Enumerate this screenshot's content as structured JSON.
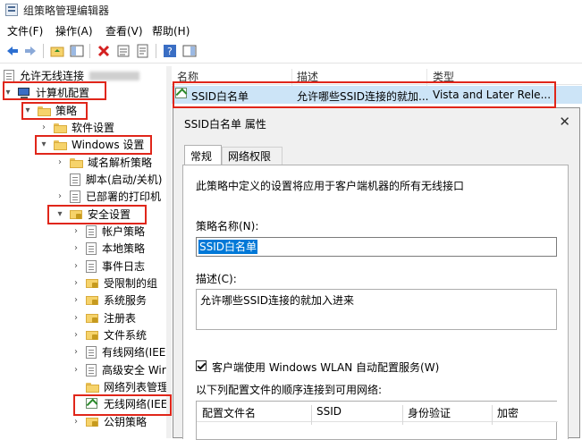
{
  "window": {
    "title": "组策略管理编辑器"
  },
  "menu": {
    "file": "文件(F)",
    "action": "操作(A)",
    "view": "查看(V)",
    "help": "帮助(H)"
  },
  "tree": {
    "root_label": "允许无线连接",
    "computer_config": "计算机配置",
    "policies": "策略",
    "software_settings": "软件设置",
    "windows_settings": "Windows 设置",
    "name_resolution": "域名解析策略",
    "scripts": "脚本(启动/关机)",
    "deployed_printers": "已部署的打印机",
    "security_settings": "安全设置",
    "account_policies": "帐户策略",
    "local_policies": "本地策略",
    "event_log": "事件日志",
    "restricted_groups": "受限制的组",
    "system_services": "系统服务",
    "registry": "注册表",
    "file_system": "文件系统",
    "wired_network": "有线网络(IEE",
    "advanced_firewall": "高级安全 Wir",
    "network_list": "网络列表管理",
    "wireless_network": "无线网络(IEE",
    "public_key": "公钥策略"
  },
  "list": {
    "columns": [
      "名称",
      "描述",
      "类型"
    ],
    "rows": [
      {
        "name": "SSID白名单",
        "desc": "允许哪些SSID连接的就加...",
        "type": "Vista and Later Rele..."
      }
    ]
  },
  "dialog": {
    "title": "SSID白名单 属性",
    "tabs": [
      "常规",
      "网络权限"
    ],
    "intro": "此策略中定义的设置将应用于客户端机器的所有无线接口",
    "name_label": "策略名称(N):",
    "name_value": "SSID白名单",
    "desc_label": "描述(C):",
    "desc_value": "允许哪些SSID连接的就加入进来",
    "wlan_checkbox_label": "客户端使用 Windows WLAN 自动配置服务(W)",
    "wlan_checked": true,
    "connect_order_label": "以下列配置文件的顺序连接到可用网络:",
    "grid_columns": [
      "配置文件名",
      "SSID",
      "身份验证",
      "加密"
    ]
  }
}
